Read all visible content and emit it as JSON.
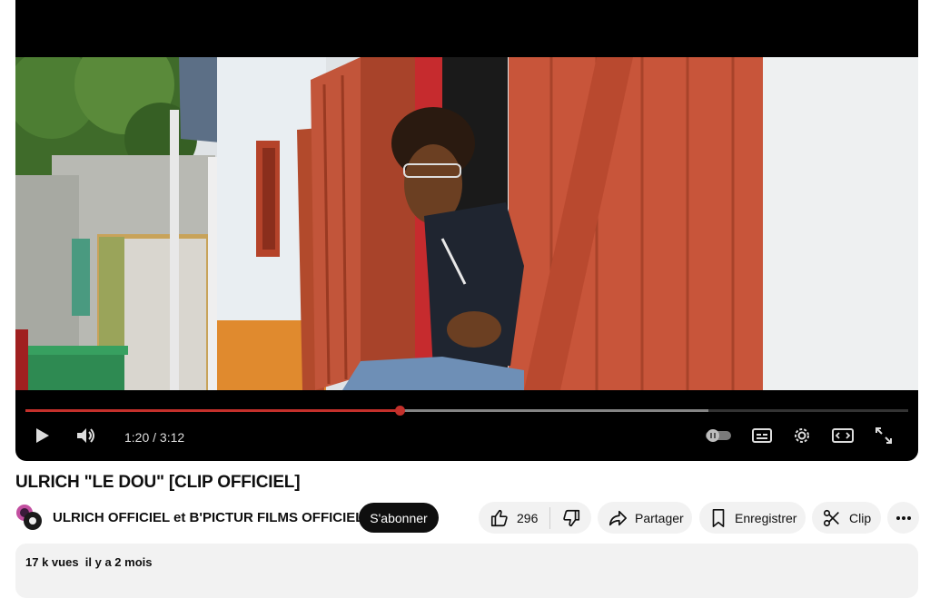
{
  "video": {
    "title": "ULRICH \"LE DOU\" [CLIP OFFICIEL]",
    "time": "1:20 / 3:12",
    "progress_fraction": 0.4236,
    "buffer_fraction": 0.7737
  },
  "channel": {
    "name": "ULRICH OFFICIEL et B'PICTUR FILMS OFFICIEL",
    "subscribe_label": "S'abonner"
  },
  "actions": {
    "like_count": "296",
    "share_label": "Partager",
    "save_label": "Enregistrer",
    "clip_label": "Clip"
  },
  "description": {
    "views": "17 k vues",
    "date": "il y a 2 mois"
  },
  "icons": {
    "play": "play-icon",
    "volume": "volume-icon",
    "autoplay": "autoplay-toggle-icon",
    "captions": "captions-icon",
    "settings": "gear-icon",
    "theater": "theater-mode-icon",
    "fullscreen": "fullscreen-icon",
    "like": "thumbs-up-icon",
    "dislike": "thumbs-down-icon",
    "share": "share-icon",
    "save": "bookmark-icon",
    "clip": "scissors-icon",
    "more": "more-icon"
  },
  "colors": {
    "progress": "#c4302b",
    "subscribe_bg": "#0f0f0f",
    "pill_bg": "#f2f2f2"
  }
}
